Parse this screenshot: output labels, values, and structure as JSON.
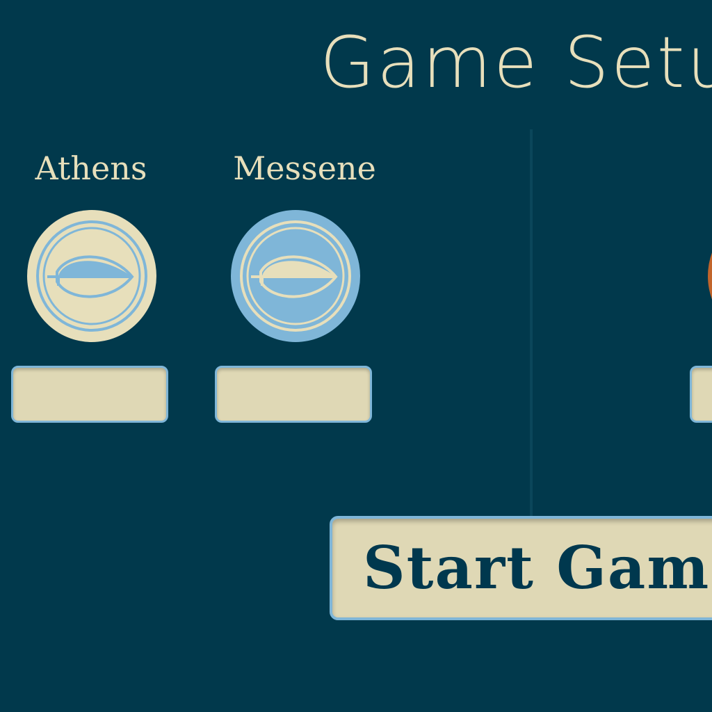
{
  "screen": {
    "title": "Game Setup"
  },
  "players": [
    {
      "city": "Athens",
      "name_value": "",
      "token_icon": "spear-shield-icon"
    },
    {
      "city": "Messene",
      "name_value": "",
      "token_icon": "spear-shield-icon"
    }
  ],
  "start_button": {
    "label": "Start Game"
  },
  "colors": {
    "background": "#01394c",
    "cream": "#e7dfbb",
    "field": "#dfd8b5",
    "light_blue": "#7fb6d8",
    "orange_token": "#c2652b"
  }
}
